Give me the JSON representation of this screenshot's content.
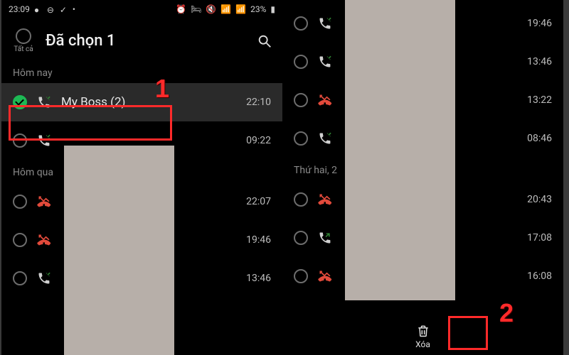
{
  "status": {
    "time": "23:09",
    "battery": "23%"
  },
  "header": {
    "title": "Đã chọn 1",
    "select_all": "Tất cả"
  },
  "left": {
    "sections": {
      "today": "Hôm nay",
      "yesterday": "Hôm qua"
    },
    "rows": [
      {
        "name": "My Boss (2)",
        "time": "22:10"
      },
      {
        "name": "",
        "time": "09:22"
      },
      {
        "name": "",
        "time": "22:07"
      },
      {
        "name": "",
        "time": "19:46"
      },
      {
        "name": "",
        "time": "13:46"
      }
    ]
  },
  "right": {
    "sections": {
      "monday": "Thứ hai, 2"
    },
    "rows": [
      {
        "time": "19:46"
      },
      {
        "time": "13:46"
      },
      {
        "time": "13:22"
      },
      {
        "time": "08:46"
      },
      {
        "time": "20:43"
      },
      {
        "time": "17:08"
      },
      {
        "time": "16:08"
      }
    ],
    "delete_label": "Xóa"
  },
  "annotations": {
    "one": "1",
    "two": "2"
  }
}
